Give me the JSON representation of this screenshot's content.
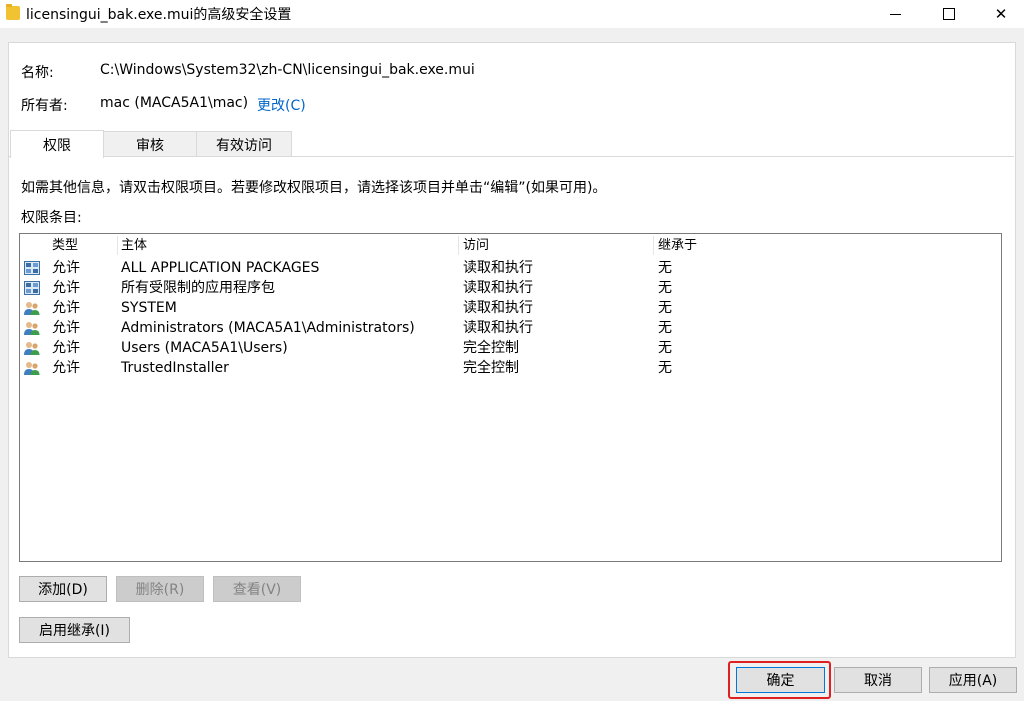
{
  "window": {
    "title": "licensingui_bak.exe.mui的高级安全设置",
    "folder_icon": "folder-icon",
    "controls": {
      "minimize": "minimize-icon",
      "maximize": "maximize-icon",
      "close": "✕"
    }
  },
  "info": {
    "name_label": "名称:",
    "name_value": "C:\\Windows\\System32\\zh-CN\\licensingui_bak.exe.mui",
    "owner_label": "所有者:",
    "owner_value": "mac (MACA5A1\\mac)",
    "change_link": "更改(C)"
  },
  "tabs": [
    {
      "label": "权限",
      "active": true
    },
    {
      "label": "审核",
      "active": false
    },
    {
      "label": "有效访问",
      "active": false
    }
  ],
  "description": "如需其他信息，请双击权限项目。若要修改权限项目，请选择该项目并单击“编辑”(如果可用)。",
  "entries_label": "权限条目:",
  "table": {
    "columns": [
      "类型",
      "主体",
      "访问",
      "继承于"
    ],
    "rows": [
      {
        "icon": "app-package-icon",
        "type": "允许",
        "principal": "ALL APPLICATION PACKAGES",
        "access": "读取和执行",
        "inherited": "无"
      },
      {
        "icon": "app-package-icon",
        "type": "允许",
        "principal": "所有受限制的应用程序包",
        "access": "读取和执行",
        "inherited": "无"
      },
      {
        "icon": "user-group-icon",
        "type": "允许",
        "principal": "SYSTEM",
        "access": "读取和执行",
        "inherited": "无"
      },
      {
        "icon": "user-group-icon",
        "type": "允许",
        "principal": "Administrators (MACA5A1\\Administrators)",
        "access": "读取和执行",
        "inherited": "无"
      },
      {
        "icon": "user-group-icon",
        "type": "允许",
        "principal": "Users (MACA5A1\\Users)",
        "access": "完全控制",
        "inherited": "无"
      },
      {
        "icon": "user-group-icon",
        "type": "允许",
        "principal": "TrustedInstaller",
        "access": "完全控制",
        "inherited": "无"
      }
    ]
  },
  "buttons": {
    "add": "添加(D)",
    "remove": "删除(R)",
    "view": "查看(V)",
    "enable_inheritance": "启用继承(I)",
    "ok": "确定",
    "cancel": "取消",
    "apply": "应用(A)"
  },
  "colors": {
    "link": "#0066cc",
    "highlight": "#e02020",
    "default_button_border": "#0078d7"
  }
}
